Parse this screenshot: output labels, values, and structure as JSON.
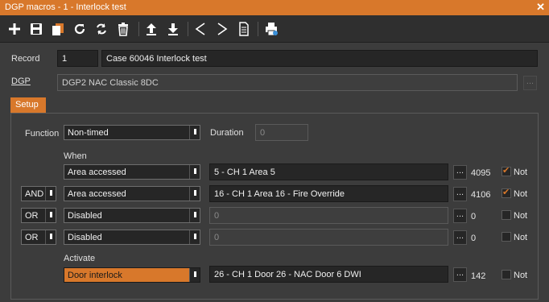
{
  "window": {
    "title": "DGP macros - 1 - Interlock test",
    "close_label": "✕"
  },
  "toolbar": {
    "icons": [
      "add-icon",
      "save-icon",
      "copy-icon",
      "refresh-icon",
      "reload-icon",
      "delete-icon",
      "upload-icon",
      "download-icon",
      "previous-icon",
      "next-icon",
      "document-icon",
      "print-icon"
    ]
  },
  "record": {
    "label": "Record",
    "number": "1",
    "name": "Case 60046 Interlock test"
  },
  "dgp": {
    "label": "DGP",
    "value": "DGP2 NAC Classic 8DC",
    "browse": "..."
  },
  "tab": {
    "label": "Setup"
  },
  "setup": {
    "function_label": "Function",
    "function_value": "Non-timed",
    "duration_label": "Duration",
    "duration_value": "0",
    "when_label": "When",
    "activate_label": "Activate",
    "conditions": [
      {
        "logic": "",
        "type": "Area accessed",
        "target": "5 - CH 1 Area 5",
        "disabled": false,
        "browse": "...",
        "id": "4095",
        "not_checked": true,
        "not_label": "Not"
      },
      {
        "logic": "AND",
        "type": "Area accessed",
        "target": "16 - CH 1 Area 16 - Fire Override",
        "disabled": false,
        "browse": "...",
        "id": "4106",
        "not_checked": true,
        "not_label": "Not"
      },
      {
        "logic": "OR",
        "type": "Disabled",
        "target": "0",
        "disabled": true,
        "browse": "...",
        "id": "0",
        "not_checked": false,
        "not_label": "Not"
      },
      {
        "logic": "OR",
        "type": "Disabled",
        "target": "0",
        "disabled": true,
        "browse": "...",
        "id": "0",
        "not_checked": false,
        "not_label": "Not"
      }
    ],
    "activate": {
      "type": "Door interlock",
      "target": "26 - CH 1 Door 26 - NAC Door 6 DWI",
      "browse": "...",
      "id": "142",
      "not_checked": false,
      "not_label": "Not"
    }
  },
  "colors": {
    "accent": "#d8782b",
    "background": "#3c3c3c",
    "field": "#262626"
  }
}
